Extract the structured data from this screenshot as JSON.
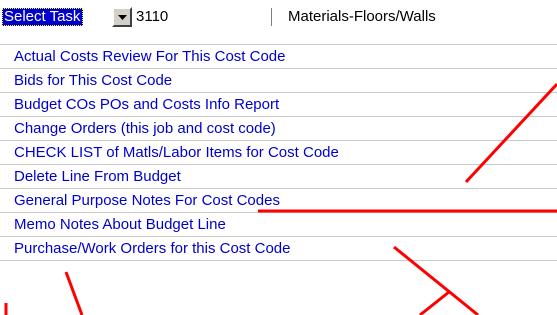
{
  "header": {
    "select_label": "Select Task",
    "code": "3110",
    "description": "Materials-Floors/Walls"
  },
  "menu": {
    "items": [
      {
        "label": "Actual Costs Review For This Cost Code"
      },
      {
        "label": "Bids for This Cost Code"
      },
      {
        "label": "Budget COs POs and Costs Info Report"
      },
      {
        "label": "Change Orders (this job and cost code)"
      },
      {
        "label": "CHECK LIST of Matls/Labor Items for Cost Code"
      },
      {
        "label": "Delete Line From Budget"
      },
      {
        "label": "General Purpose Notes For Cost Codes"
      },
      {
        "label": "Memo Notes About Budget Line"
      },
      {
        "label": "Purchase/Work Orders for this Cost Code"
      }
    ]
  },
  "icons": {
    "dropdown": "dropdown-arrow-icon"
  },
  "colors": {
    "link": "#0000cc",
    "highlight": "#0000cc",
    "annotation_arrow": "#ff0000"
  }
}
